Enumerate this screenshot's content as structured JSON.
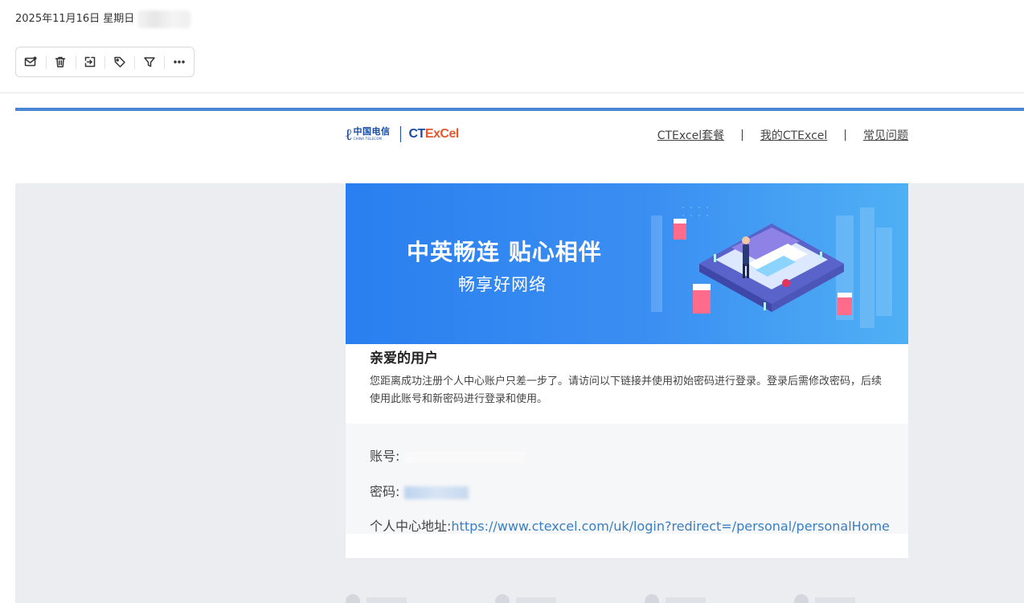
{
  "header": {
    "date": "2025年11月16日 星期日"
  },
  "toolbar": {
    "buttons": [
      {
        "name": "mark-read-icon"
      },
      {
        "name": "trash-icon"
      },
      {
        "name": "move-icon"
      },
      {
        "name": "tag-icon"
      },
      {
        "name": "filter-icon"
      },
      {
        "name": "more-icon"
      }
    ]
  },
  "email": {
    "brand": {
      "carrier_cn": "中国电信",
      "carrier_en": "CHINA TELECOM",
      "product_part1": "CT",
      "product_part2": "ExCel"
    },
    "nav": {
      "link1": "CTExcel套餐",
      "link2": "我的CTExcel",
      "link3": "常见问题",
      "separator": "|"
    },
    "banner": {
      "title": "中英畅连 贴心相伴",
      "subtitle": "畅享好网络"
    },
    "greeting": "亲爱的用户",
    "body": "您距离成功注册个人中心账户只差一步了。请访问以下链接并使用初始密码进行登录。登录后需修改密码，后续使用此账号和新密码进行登录和使用。",
    "account_label": "账号:",
    "account_value": "",
    "password_label": "密码:",
    "password_value": "",
    "portal_label": "个人中心地址:",
    "portal_url": "https://www.ctexcel.com/uk/login?redirect=/personal/personalHome"
  },
  "colors": {
    "accent_bar": "#4a86d4",
    "link": "#3a7fc1",
    "banner_start": "#2a7ff0",
    "banner_end": "#4fb0f4"
  }
}
